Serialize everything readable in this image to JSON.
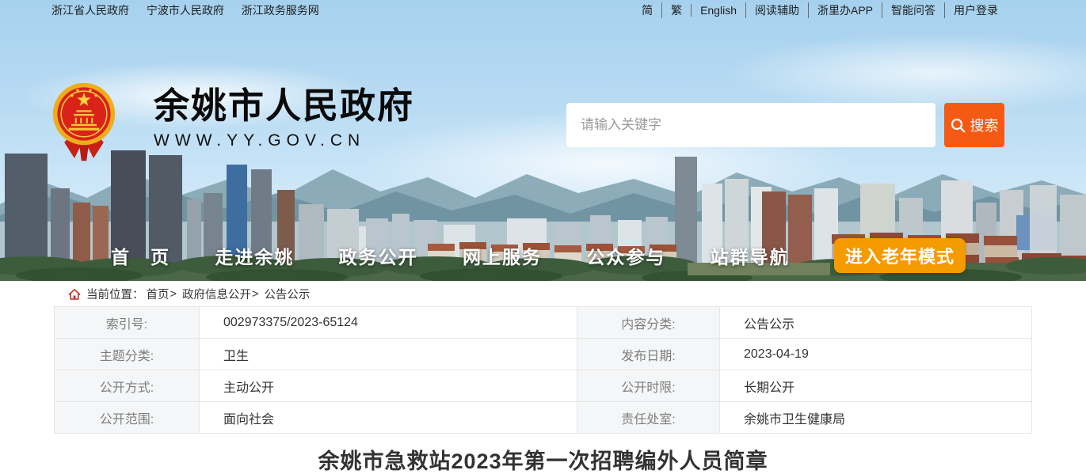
{
  "topbar": {
    "left_links": [
      "浙江省人民政府",
      "宁波市人民政府",
      "浙江政务服务网"
    ],
    "right_links": [
      "简",
      "繁",
      "English",
      "阅读辅助",
      "浙里办APP",
      "智能问答",
      "用户登录"
    ]
  },
  "header": {
    "site_title": "余姚市人民政府",
    "site_url": "WWW.YY.GOV.CN",
    "search": {
      "placeholder": "请输入关键字",
      "button_label": "搜索"
    }
  },
  "nav": {
    "items": [
      "首　页",
      "走进余姚",
      "政务公开",
      "网上服务",
      "公众参与",
      "站群导航"
    ],
    "elder_mode_label": "进入老年模式"
  },
  "breadcrumb": {
    "prefix": "当前位置：",
    "items": [
      "首页",
      "政府信息公开",
      "公告公示"
    ],
    "separator": ">"
  },
  "info_table": {
    "rows": [
      {
        "label1": "索引号:",
        "value1": "002973375/2023-65124",
        "label2": "内容分类:",
        "value2": "公告公示"
      },
      {
        "label1": "主题分类:",
        "value1": "卫生",
        "label2": "发布日期:",
        "value2": "2023-04-19"
      },
      {
        "label1": "公开方式:",
        "value1": "主动公开",
        "label2": "公开时限:",
        "value2": "长期公开"
      },
      {
        "label1": "公开范围:",
        "value1": "面向社会",
        "label2": "责任处室:",
        "value2": "余姚市卫生健康局"
      }
    ]
  },
  "article": {
    "title": "余姚市急救站2023年第一次招聘编外人员简章"
  },
  "colors": {
    "search_button_orange": "#f55a15",
    "elder_button_orange": "#f59b00",
    "emblem_red": "#d92318",
    "emblem_gold": "#eead1b",
    "home_icon_red": "#c5302b",
    "nav_text": "#ffffff",
    "label_cell_bg": "#f5f6f7"
  }
}
